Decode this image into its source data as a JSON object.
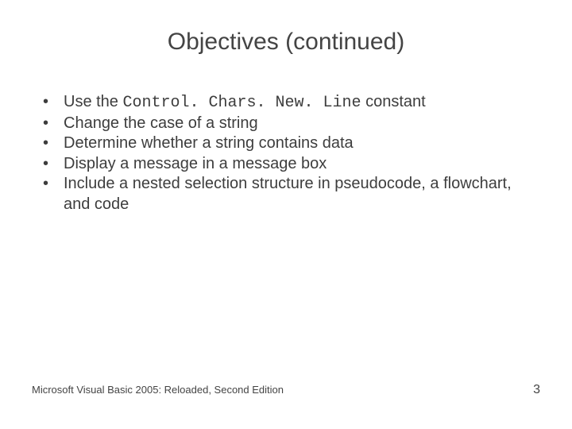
{
  "title": "Objectives (continued)",
  "bullets": [
    {
      "runs": [
        {
          "text": "Use the ",
          "mono": false
        },
        {
          "text": "Control. Chars. New. Line",
          "mono": true
        },
        {
          "text": " constant",
          "mono": false
        }
      ]
    },
    {
      "runs": [
        {
          "text": "Change the case of a string",
          "mono": false
        }
      ]
    },
    {
      "runs": [
        {
          "text": "Determine whether a string contains data",
          "mono": false
        }
      ]
    },
    {
      "runs": [
        {
          "text": "Display a message in a message box",
          "mono": false
        }
      ]
    },
    {
      "runs": [
        {
          "text": "Include a nested selection structure in pseudocode, a flowchart, and code",
          "mono": false
        }
      ]
    }
  ],
  "footer": {
    "text": "Microsoft Visual Basic 2005: Reloaded, Second Edition",
    "page": "3"
  }
}
